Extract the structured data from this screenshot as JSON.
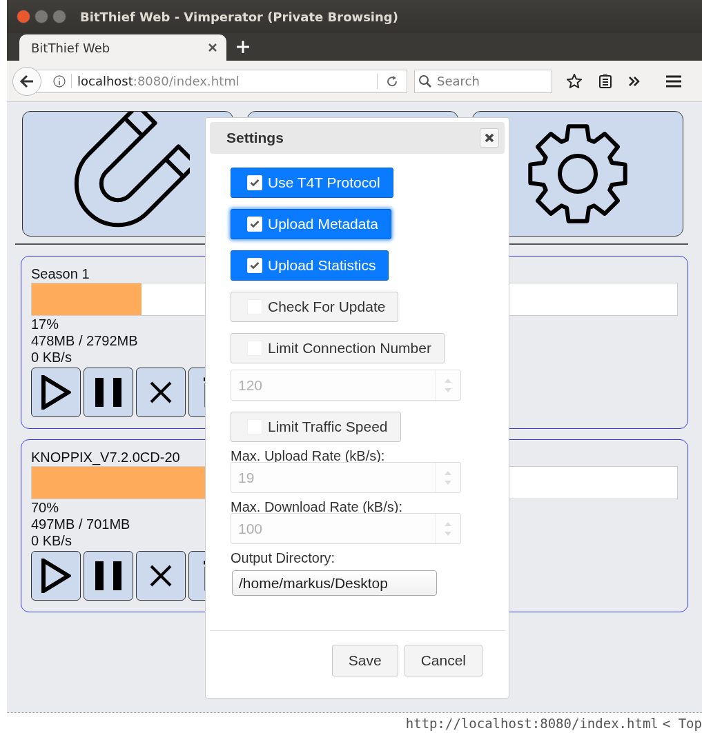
{
  "window": {
    "title": "BitThief Web - Vimperator (Private Browsing)"
  },
  "tabs": [
    {
      "label": "BitThief Web",
      "selected": true
    }
  ],
  "address_bar": {
    "url": "**localhost**:8080/index.html"
  },
  "search": {
    "placeholder": "Search"
  },
  "torrents": [
    {
      "name": "Season 1",
      "level": 0.17,
      "percent": "17%",
      "size": "478MB / 2792MB",
      "speed": "0 KB/s"
    },
    {
      "name": "KNOPPIX_V7.2.0CD-20",
      "level": 0.7,
      "percent": "70%",
      "size": "497MB / 701MB",
      "speed": "0 KB/s"
    }
  ],
  "dialog": {
    "title": "Settings",
    "items": [
      {
        "kind": "toggle",
        "label": "Use T4T Protocol",
        "checked": true,
        "focused": false
      },
      {
        "kind": "toggle",
        "label": "Upload Metadata",
        "checked": true,
        "focused": true
      },
      {
        "kind": "toggle",
        "label": "Upload Statistics",
        "checked": true,
        "focused": false
      },
      {
        "kind": "toggle",
        "label": "Check For Update",
        "checked": false,
        "focused": false
      },
      {
        "kind": "toggle",
        "label": "Limit Connection Number",
        "checked": false,
        "focused": false
      },
      {
        "kind": "number",
        "value": "120",
        "disabled": true
      },
      {
        "kind": "toggle",
        "label": "Limit Traffic Speed",
        "checked": false,
        "focused": false
      },
      {
        "kind": "label",
        "text": "Max. Upload Rate (kB/s):"
      },
      {
        "kind": "number",
        "value": "19",
        "disabled": true
      },
      {
        "kind": "label",
        "text": "Max. Download Rate (kB/s):"
      },
      {
        "kind": "number",
        "value": "100",
        "disabled": true
      },
      {
        "kind": "label",
        "text": "Output Directory:"
      },
      {
        "kind": "text",
        "value": "/home/markus/Desktop"
      }
    ],
    "buttons": [
      "Save",
      "Cancel"
    ]
  },
  "status_bar": {
    "url": "http://localhost:8080/index.html",
    "position": "< Top"
  }
}
